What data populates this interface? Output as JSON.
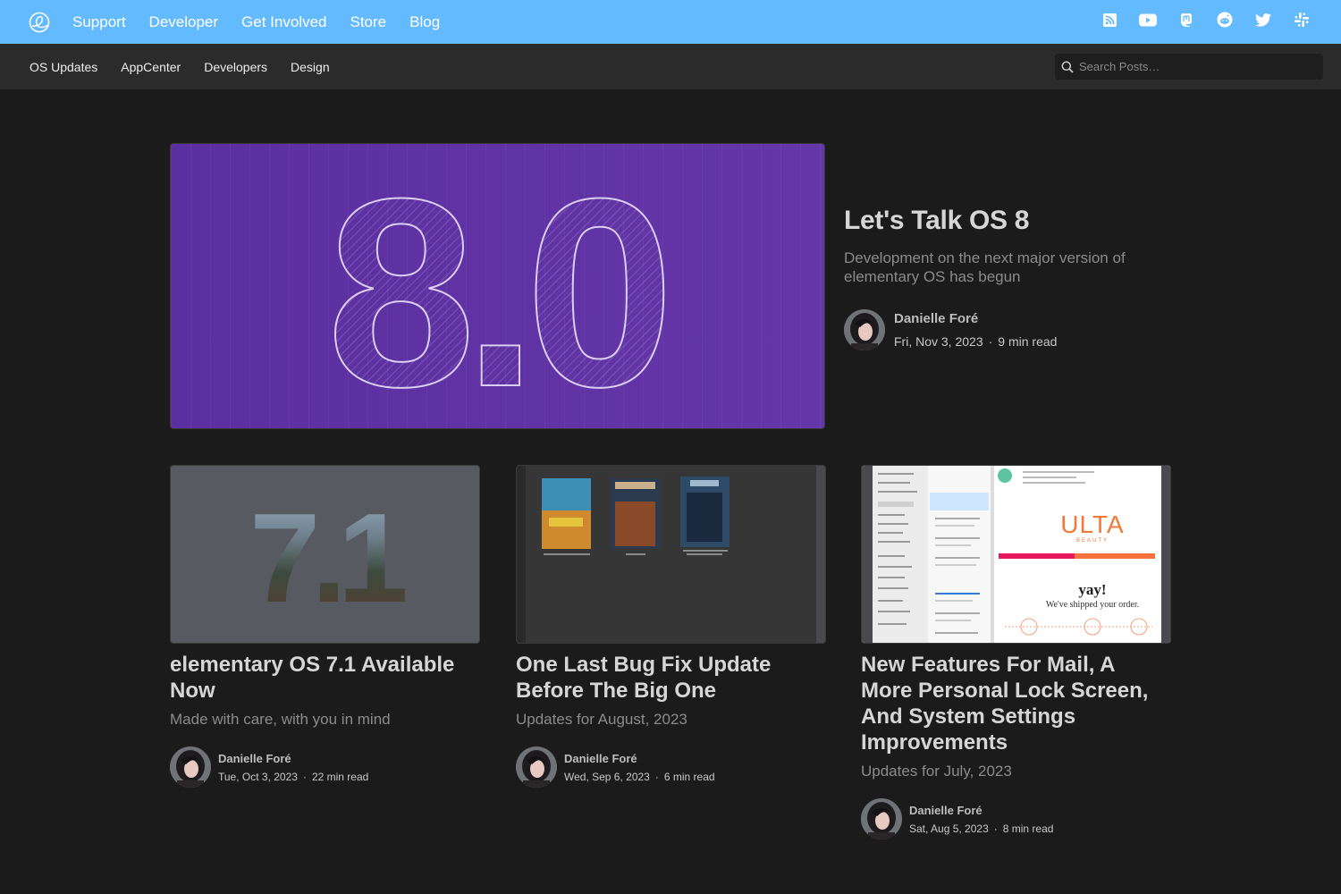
{
  "top_nav": {
    "items": [
      "Support",
      "Developer",
      "Get Involved",
      "Store",
      "Blog"
    ],
    "social_icons": [
      "rss-icon",
      "youtube-icon",
      "mastodon-icon",
      "reddit-icon",
      "twitter-icon",
      "slack-icon"
    ]
  },
  "sub_nav": {
    "items": [
      "OS Updates",
      "AppCenter",
      "Developers",
      "Design"
    ],
    "search_placeholder": "Search Posts…"
  },
  "featured": {
    "image_text": "8.0",
    "title": "Let's Talk OS 8",
    "subtitle": "Development on the next major version of elementary OS has begun",
    "author": "Danielle Foré",
    "date": "Fri, Nov 3, 2023",
    "read_time": "9 min read"
  },
  "posts": [
    {
      "image_text": "7.1",
      "title": "elementary OS 7.1 Available Now",
      "subtitle": "Made with care, with you in mind",
      "author": "Danielle Foré",
      "date": "Tue, Oct 3, 2023",
      "read_time": "22 min read"
    },
    {
      "title": "One Last Bug Fix Update Before The Big One",
      "subtitle": "Updates for August, 2023",
      "author": "Danielle Foré",
      "date": "Wed, Sep 6, 2023",
      "read_time": "6 min read"
    },
    {
      "image_text_brand": "ULTA",
      "image_text_brand_sub": "BEAUTY",
      "image_text_yay": "yay!",
      "image_text_shipped": "We've shipped your order.",
      "title": "New Features For Mail, A More Personal Lock Screen, And System Settings Improvements",
      "subtitle": "Updates for July, 2023",
      "author": "Danielle Foré",
      "date": "Sat, Aug 5, 2023",
      "read_time": "8 min read"
    }
  ],
  "colors": {
    "top_bar": "#64baff",
    "sub_bar": "#2b2b2b",
    "background": "#1b1b1b",
    "hero_purple": "#6436a8"
  }
}
